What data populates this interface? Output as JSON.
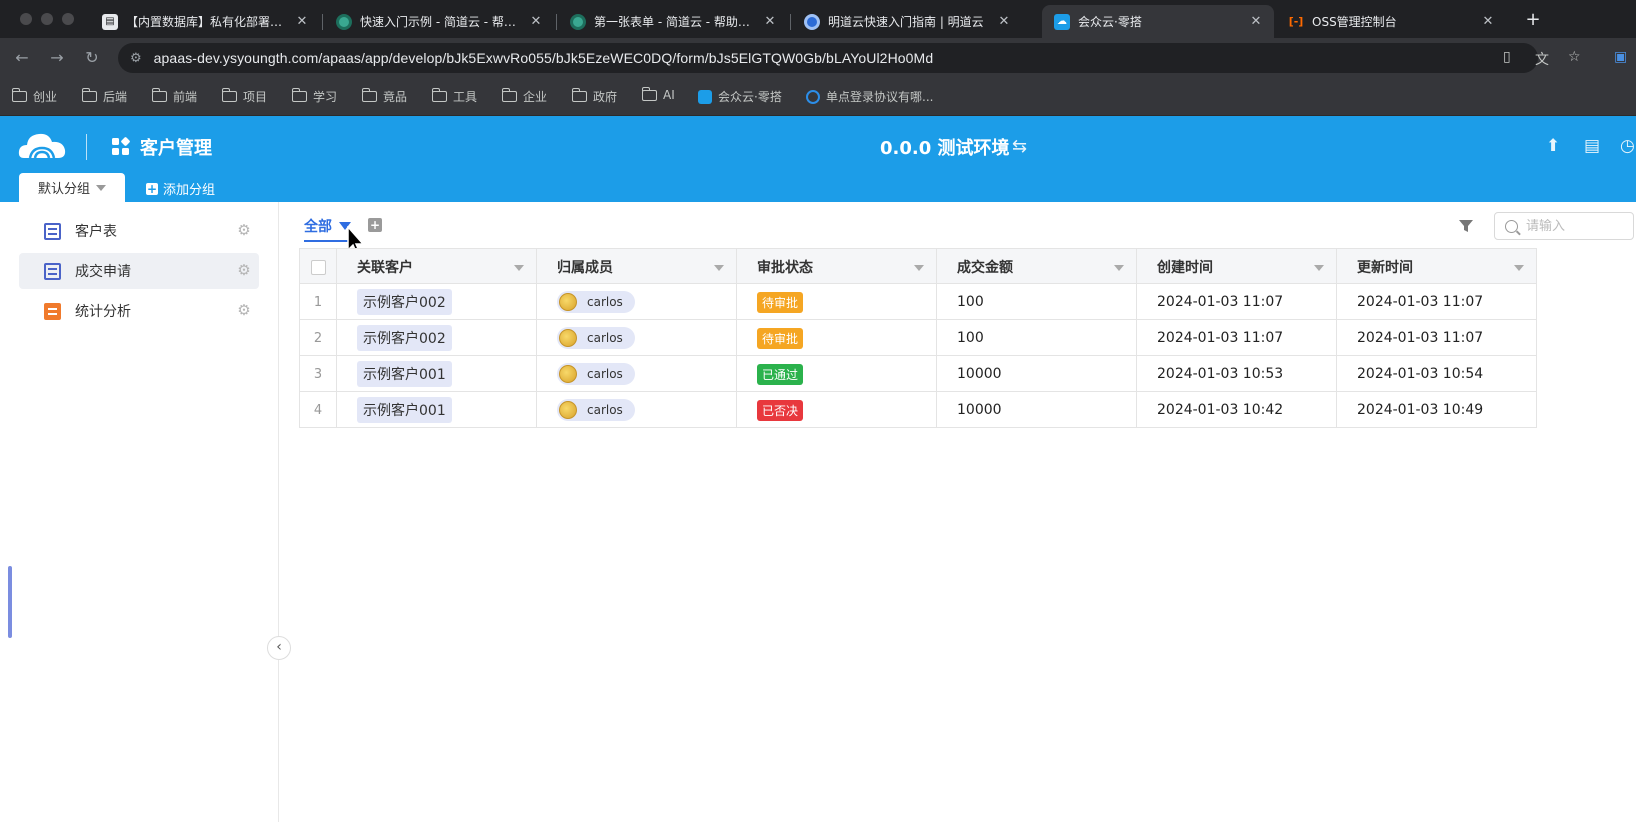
{
  "browser": {
    "tabs": [
      {
        "title": "【内置数据库】私有化部署流程",
        "color": "#e8eaed",
        "fav": "doc"
      },
      {
        "title": "快速入门示例 - 简道云 - 帮助文档",
        "color": "#3aa891",
        "fav": "jdy"
      },
      {
        "title": "第一张表单 - 简道云 - 帮助文档",
        "color": "#3aa891",
        "fav": "jdy"
      },
      {
        "title": "明道云快速入门指南 | 明道云",
        "color": "#2c6bd6",
        "fav": "mdy"
      },
      {
        "title": "会众云·零搭",
        "color": "#1c9de8",
        "fav": "cloud"
      },
      {
        "title": "OSS管理控制台",
        "color": "#ff6a00",
        "fav": "oss"
      }
    ],
    "url": "apaas-dev.ysyoungth.com/apaas/app/develop/bJk5ExwvRo055/bJk5EzeWEC0DQ/form/bJs5ElGTQW0Gb/bLAYoUl2Ho0Md",
    "bookmarks": [
      "创业",
      "后端",
      "前端",
      "项目",
      "学习",
      "竟品",
      "工具",
      "企业",
      "政府",
      "AI",
      "会众云·零搭",
      "单点登录协议有哪..."
    ]
  },
  "app": {
    "title": "客户管理",
    "env": "0.0.0 测试环境",
    "group_tab": "默认分组",
    "add_group": "添加分组",
    "accent": "#1c9de8"
  },
  "sidebar": {
    "items": [
      {
        "label": "客户表"
      },
      {
        "label": "成交申请"
      },
      {
        "label": "统计分析"
      }
    ]
  },
  "view": {
    "tab": "全部",
    "search_placeholder": "请输入"
  },
  "table": {
    "columns": [
      "关联客户",
      "归属成员",
      "审批状态",
      "成交金额",
      "创建时间",
      "更新时间"
    ],
    "rows": [
      {
        "idx": "1",
        "customer": "示例客户002",
        "member": "carlos",
        "status": "待审批",
        "status_color": "#f5a623",
        "amount": "100",
        "created": "2024-01-03 11:07",
        "updated": "2024-01-03 11:07"
      },
      {
        "idx": "2",
        "customer": "示例客户002",
        "member": "carlos",
        "status": "待审批",
        "status_color": "#f5a623",
        "amount": "100",
        "created": "2024-01-03 11:07",
        "updated": "2024-01-03 11:07"
      },
      {
        "idx": "3",
        "customer": "示例客户001",
        "member": "carlos",
        "status": "已通过",
        "status_color": "#2bb24c",
        "amount": "10000",
        "created": "2024-01-03 10:53",
        "updated": "2024-01-03 10:54"
      },
      {
        "idx": "4",
        "customer": "示例客户001",
        "member": "carlos",
        "status": "已否决",
        "status_color": "#e8383d",
        "amount": "10000",
        "created": "2024-01-03 10:42",
        "updated": "2024-01-03 10:49"
      }
    ]
  }
}
